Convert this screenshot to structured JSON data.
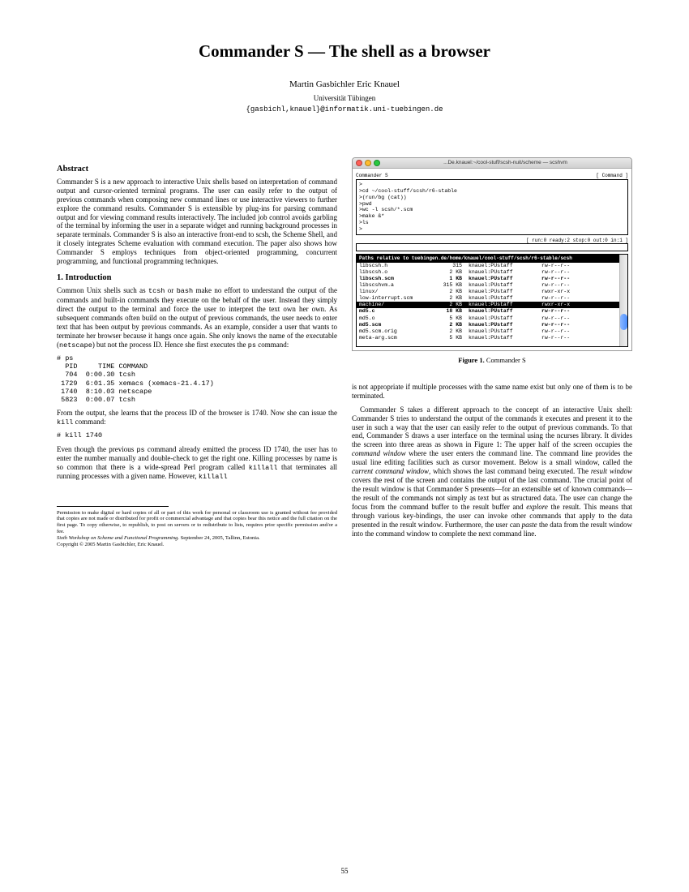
{
  "title": "Commander S — The shell as a browser",
  "authors": "Martin Gasbichler      Eric Knauel",
  "affiliation": "Universität Tübingen",
  "email": "{gasbichl,knauel}@informatik.uni-tuebingen.de",
  "abstract_heading": "Abstract",
  "abstract_text": "Commander S is a new approach to interactive Unix shells based on interpretation of command output and cursor-oriented terminal programs. The user can easily refer to the output of previous commands when composing new command lines or use interactive viewers to further explore the command results. Commander S is extensible by plug-ins for parsing command output and for viewing command results interactively. The included job control avoids garbling of the terminal by informing the user in a separate widget and running background processes in separate terminals. Commander S is also an interactive front-end to scsh, the Scheme Shell, and it closely integrates Scheme evaluation with command execution. The paper also shows how Commander S employs techniques from object-oriented programming, concurrent programming, and functional programming techniques.",
  "intro_heading": "1.    Introduction",
  "intro_p1a": "Common Unix shells such as ",
  "intro_p1_code1": "tcsh",
  "intro_p1b": " or ",
  "intro_p1_code2": "bash",
  "intro_p1c": " make no effort to understand the output of the commands and built-in commands they execute on the behalf of the user. Instead they simply direct the output to the terminal and force the user to interpret the text own her own. As subsequent commands often build on the output of previous commands, the user needs to enter text that has been output by previous commands. As an example, consider a user that wants to terminate her browser because it hangs once again. She only knows the name of the executable (",
  "intro_p1_code3": "netscape",
  "intro_p1d": ") but not the process ID. Hence she first executes the ",
  "intro_p1_code4": "ps",
  "intro_p1e": " command:",
  "ps_output": "# ps\n  PID     TIME COMMAND\n  704  0:00.30 tcsh\n 1729  6:01.35 xemacs (xemacs-21.4.17)\n 1740  8:10.03 netscape\n 5823  0:00.07 tcsh",
  "intro_p2a": "From the output, she learns that the process ID of the browser is 1740. Now she can issue the ",
  "intro_p2_code1": "kill",
  "intro_p2b": " command:",
  "kill_cmd": "# kill 1740",
  "intro_p3a": "Even though the previous ",
  "intro_p3_code1": "ps",
  "intro_p3b": " command already emitted the process ID 1740, the user has to enter the number manually and double-check to get the right one. Killing processes by name is so common that there is a wide-spread Perl program called ",
  "intro_p3_code2": "killall",
  "intro_p3c": " that terminates all running processes with a given name. However, ",
  "intro_p3_code3": "killall",
  "footnote_perm": "Permission to make digital or hard copies of all or part of this work for personal or classroom use is granted without fee provided that copies are not made or distributed for profit or commercial advantage and that copies bear this notice and the full citation on the first page. To copy otherwise, to republish, to post on servers or to redistribute to lists, requires prior specific permission and/or a fee.",
  "footnote_venue": "Sixth Workshop on Scheme and Functional Programming.",
  "footnote_venue2": "   September 24, 2005, Tallinn, Estonia.",
  "footnote_copy": "Copyright © 2005 Martin Gasbichler, Eric Knauel.",
  "screenshot": {
    "titlebar": "...De.knauel:~/cool-stuff/scsh-nuit/scheme — scshvm",
    "app_label": "Commander S",
    "command_label": "[ Command ]",
    "commands": ">\n>cd ~/cool-stuff/scsh/r6-stable\n>(run/bg (cat))\n>pwd\n>wc -l scsh/*.scm\n>make &*\n>ls\n>",
    "status": "[ run:0 ready:2 stop:0 out:0 in:1 ]",
    "result_header": "Paths relative to tuebingen.de/home/knauel/cool-stuff/scsh/r6-stable/scsh",
    "rows": [
      {
        "name": "libscsh.h",
        "size": "315",
        "owner": "knauel:PUstaff",
        "perm": "rw-r--r--",
        "sel": false,
        "bold": false
      },
      {
        "name": "libscsh.o",
        "size": "2 KB",
        "owner": "knauel:PUstaff",
        "perm": "rw-r--r--",
        "sel": false,
        "bold": false
      },
      {
        "name": "libscsh.scm",
        "size": "1 KB",
        "owner": "knauel:PUstaff",
        "perm": "rw-r--r--",
        "sel": false,
        "bold": true
      },
      {
        "name": "libscshvm.a",
        "size": "315 KB",
        "owner": "knauel:PUstaff",
        "perm": "rw-r--r--",
        "sel": false,
        "bold": false
      },
      {
        "name": "linux/",
        "size": "2 KB",
        "owner": "knauel:PUstaff",
        "perm": "rwxr-xr-x",
        "sel": false,
        "bold": false
      },
      {
        "name": "low-interrupt.scm",
        "size": "2 KB",
        "owner": "knauel:PUstaff",
        "perm": "rw-r--r--",
        "sel": false,
        "bold": false
      },
      {
        "name": "machine/",
        "size": "2 KB",
        "owner": "knauel:PUstaff",
        "perm": "rwxr-xr-x",
        "sel": true,
        "bold": false
      },
      {
        "name": "md5.c",
        "size": "18 KB",
        "owner": "knauel:PUstaff",
        "perm": "rw-r--r--",
        "sel": false,
        "bold": true
      },
      {
        "name": "md5.o",
        "size": "5 KB",
        "owner": "knauel:PUstaff",
        "perm": "rw-r--r--",
        "sel": false,
        "bold": false
      },
      {
        "name": "md5.scm",
        "size": "2 KB",
        "owner": "knauel:PUstaff",
        "perm": "rw-r--r--",
        "sel": false,
        "bold": true
      },
      {
        "name": "md5.scm.orig",
        "size": "2 KB",
        "owner": "knauel:PUstaff",
        "perm": "rw-r--r--",
        "sel": false,
        "bold": false
      },
      {
        "name": "meta-arg.scm",
        "size": "5 KB",
        "owner": "knauel:PUstaff",
        "perm": "rw-r--r--",
        "sel": false,
        "bold": false
      }
    ]
  },
  "fig_caption_label": "Figure 1.",
  "fig_caption_text": " Commander S",
  "col2_p1": "is not appropriate if multiple processes with the same name exist but only one of them is to be terminated.",
  "col2_p2a": "Commander S takes a different approach to the concept of an interactive Unix shell: Commander S tries to understand the output of the commands it executes and present it to the user in such a way that the user can easily refer to the output of previous commands. To that end, Commander S draws a user interface on the terminal using the ncurses library. It divides the screen into three areas as shown in Figure 1: The upper half of the screen occupies the ",
  "col2_p2_i1": "command window",
  "col2_p2b": " where the user enters the command line. The command line provides the usual line editing facilities such as cursor movement. Below is a small window, called the ",
  "col2_p2_i2": "current command window",
  "col2_p2c": ", which shows the last command being executed. The ",
  "col2_p2_i3": "result window",
  "col2_p2d": " covers the rest of the screen and contains the output of the last command. The crucial point of the result window is that Commander S presents—for an extensible set of known commands—the result of the commands not simply as text but as structured data. The user can change the focus from the command buffer to the result buffer and ",
  "col2_p2_i4": "explore",
  "col2_p2e": " the result. This means that through various key-bindings, the user can invoke other commands that apply to the data presented in the result window. Furthermore, the user can ",
  "col2_p2_i5": "paste",
  "col2_p2f": " the data from the result window into the command window to complete the next command line.",
  "page_number": "55"
}
